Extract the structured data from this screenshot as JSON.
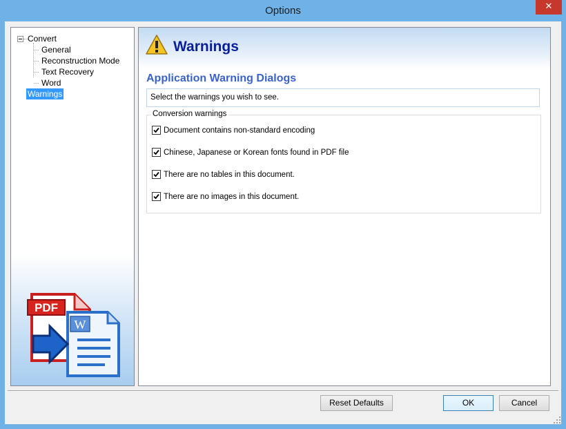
{
  "window": {
    "title": "Options",
    "close_label": "✕"
  },
  "tree": {
    "root": "Convert",
    "children": [
      "General",
      "Reconstruction Mode",
      "Text Recovery",
      "Word"
    ],
    "selected": "Warnings"
  },
  "logo": {
    "pdf_label": "PDF",
    "word_label": "W"
  },
  "panel": {
    "title": "Warnings",
    "section_title": "Application Warning Dialogs",
    "description": "Select the warnings you wish to see.",
    "group_label": "Conversion warnings",
    "warnings": [
      {
        "label": "Document contains non-standard encoding",
        "checked": true
      },
      {
        "label": "Chinese, Japanese or Korean fonts found in PDF file",
        "checked": true
      },
      {
        "label": "There are no tables in this document.",
        "checked": true
      },
      {
        "label": "There are no images in this document.",
        "checked": true
      }
    ]
  },
  "buttons": {
    "reset": "Reset Defaults",
    "ok": "OK",
    "cancel": "Cancel"
  },
  "colors": {
    "title_blue": "#0a1e9b",
    "section_blue": "#3b62c9",
    "selection": "#3399ff",
    "close_red": "#c7382c"
  }
}
